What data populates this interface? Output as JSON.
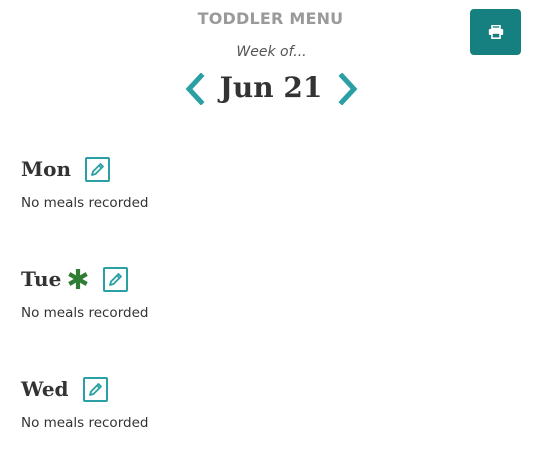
{
  "header": {
    "title": "TODDLER MENU",
    "print_icon": "printer-icon"
  },
  "week_nav": {
    "subtitle": "Week of...",
    "date": "Jun 21",
    "prev_icon": "chevron-left-icon",
    "next_icon": "chevron-right-icon"
  },
  "days": [
    {
      "name": "Mon",
      "marker": "",
      "status": "No meals recorded",
      "edit_icon": "pencil-square-icon"
    },
    {
      "name": "Tue",
      "marker": "asterisk-icon",
      "status": "No meals recorded",
      "edit_icon": "pencil-square-icon"
    },
    {
      "name": "Wed",
      "marker": "",
      "status": "No meals recorded",
      "edit_icon": "pencil-square-icon"
    }
  ],
  "colors": {
    "accent": "#2aa0a4",
    "print_button": "#167f80",
    "asterisk": "#2e7d32",
    "title_gray": "#9a9a9a",
    "text": "#333333"
  }
}
